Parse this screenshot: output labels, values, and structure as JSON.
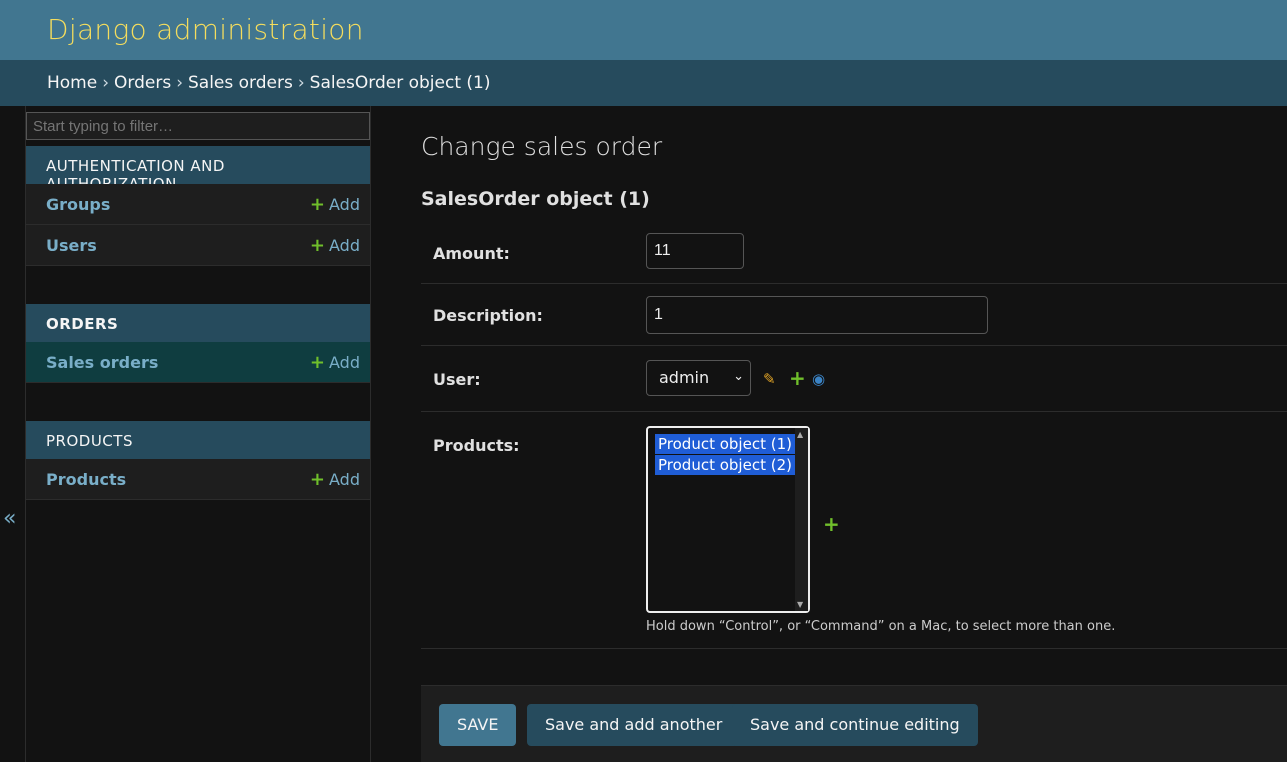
{
  "header": {
    "brand": "Django administration"
  },
  "breadcrumbs": [
    "Home",
    "Orders",
    "Sales orders",
    "SalesOrder object (1)"
  ],
  "breadcrumb_separator": "›",
  "sidebar": {
    "toggle_glyph": "«",
    "filter_placeholder": "Start typing to filter…",
    "modules": [
      {
        "title": "AUTHENTICATION AND AUTHORIZATION",
        "items": [
          {
            "label": "Groups",
            "add": "Add"
          },
          {
            "label": "Users",
            "add": "Add"
          }
        ]
      },
      {
        "title": "ORDERS",
        "items": [
          {
            "label": "Sales orders",
            "add": "Add",
            "current": true
          }
        ]
      },
      {
        "title": "PRODUCTS",
        "items": [
          {
            "label": "Products",
            "add": "Add"
          }
        ]
      }
    ]
  },
  "content": {
    "page_title": "Change sales order",
    "object_title": "SalesOrder object (1)",
    "fields": {
      "amount": {
        "label": "Amount:",
        "value": "11"
      },
      "description": {
        "label": "Description:",
        "value": "1"
      },
      "user": {
        "label": "User:",
        "selected": "admin"
      },
      "products": {
        "label": "Products:",
        "options": [
          "Product object (1)",
          "Product object (2)"
        ],
        "help": "Hold down “Control”, or “Command” on a Mac, to select more than one."
      }
    },
    "buttons": {
      "save": "SAVE",
      "save_add_another": "Save and add another",
      "save_continue": "Save and continue editing"
    }
  },
  "icons": {
    "plus": "+",
    "edit": "✎",
    "view": "◉",
    "caret": "⌄",
    "scroll_up": "▲",
    "scroll_down": "▼"
  },
  "colors": {
    "header": "#417690",
    "breadcrumbs": "#264b5d",
    "brand": "#f5dd5d",
    "link": "#79aec8",
    "add_green": "#70bf2b",
    "selected_option": "#1f5dd6"
  }
}
